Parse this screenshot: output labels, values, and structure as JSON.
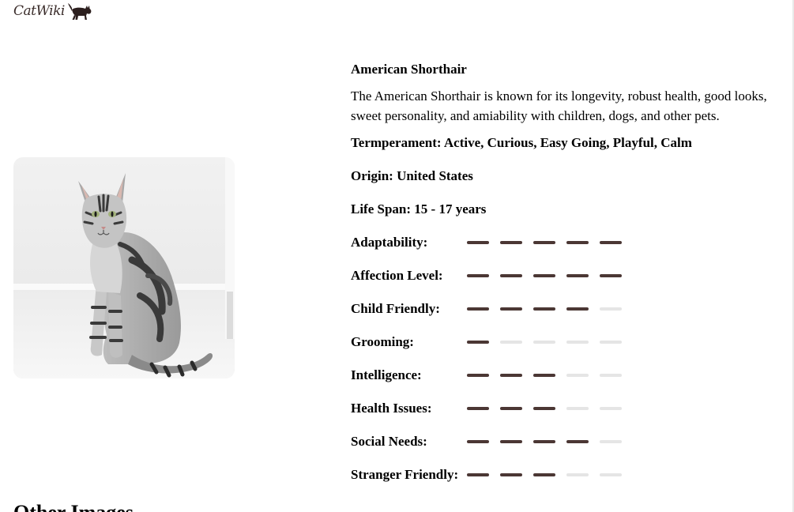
{
  "header": {
    "logo_text": "CatWiki",
    "logo_icon": "cat-icon"
  },
  "breed": {
    "photo_icon": "cat-photo",
    "name": "American Shorthair",
    "description": "The American Shorthair is known for its longevity, robust health, good looks, sweet personality, and amiability with children, dogs, and other pets.",
    "temperament": "Termperament: Active, Curious, Easy Going, Playful, Calm",
    "origin": "Origin: United States",
    "life_span": "Life Span: 15 - 17 years",
    "ratings": [
      {
        "label": "Adaptability:",
        "value": 5,
        "max": 5
      },
      {
        "label": "Affection Level:",
        "value": 5,
        "max": 5
      },
      {
        "label": "Child Friendly:",
        "value": 4,
        "max": 5
      },
      {
        "label": "Grooming:",
        "value": 1,
        "max": 5
      },
      {
        "label": "Intelligence:",
        "value": 3,
        "max": 5
      },
      {
        "label": "Health Issues:",
        "value": 3,
        "max": 5
      },
      {
        "label": "Social Needs:",
        "value": 4,
        "max": 5
      },
      {
        "label": "Stranger Friendly:",
        "value": 3,
        "max": 5
      }
    ]
  },
  "other_photos": {
    "heading": "Other Images"
  },
  "colors": {
    "accent": "#4b3734",
    "inactive_bar": "#e5e5e5",
    "text": "#000000"
  }
}
